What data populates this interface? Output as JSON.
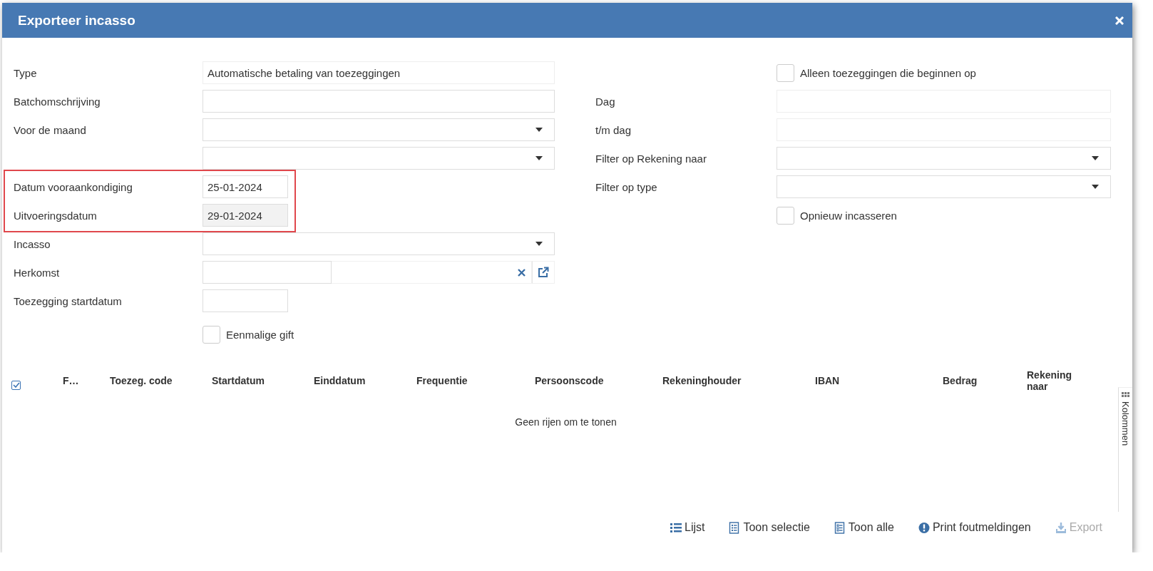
{
  "window": {
    "title": "Exporteer incasso"
  },
  "form_left": [
    {
      "kind": "text",
      "label": "Type",
      "value": "Automatische betaling van toezeggingen",
      "readonly": true
    },
    {
      "kind": "text",
      "label": "Batchomschrijving"
    },
    {
      "kind": "select",
      "label": "Voor de maand"
    },
    {
      "kind": "select"
    },
    {
      "kind": "group",
      "highlighted": true,
      "fields": [
        {
          "kind": "date",
          "label": "Datum vooraankondiging",
          "value": "25-01-2024"
        },
        {
          "kind": "date",
          "label": "Uitvoeringsdatum",
          "value": "29-01-2024",
          "disabled": true
        }
      ]
    },
    {
      "kind": "select",
      "label": "Incasso"
    },
    {
      "kind": "lookup",
      "label": "Herkomst"
    },
    {
      "kind": "date",
      "label": "Toezegging startdatum"
    },
    {
      "kind": "checkbox",
      "label": "Eenmalige gift",
      "checked": false
    }
  ],
  "form_right": [
    {
      "kind": "checkbox",
      "label": "Alleen toezeggingen die beginnen op",
      "checked": false
    },
    {
      "kind": "text",
      "label": "Dag",
      "readonly": true
    },
    {
      "kind": "text",
      "label": "t/m dag",
      "readonly": true
    },
    {
      "kind": "select",
      "label": "Filter op Rekening naar"
    },
    {
      "kind": "select",
      "label": "Filter op type"
    },
    {
      "kind": "checkbox",
      "label": "Opnieuw incasseren",
      "checked": false
    }
  ],
  "table": {
    "select_all": {
      "checked": true
    },
    "columns": [
      "F…",
      "Toezeg. code",
      "Startdatum",
      "Einddatum",
      "Frequentie",
      "Persoonscode",
      "Rekeninghouder",
      "IBAN",
      "Bedrag",
      "Rekening naar"
    ],
    "empty_message": "Geen rijen om te tonen",
    "side_tab": "Kolommen"
  },
  "footer_buttons": [
    {
      "kind": "list",
      "label": "Lijst",
      "disabled": false
    },
    {
      "kind": "selection",
      "label": "Toon selectie",
      "disabled": false
    },
    {
      "kind": "all",
      "label": "Toon alle",
      "disabled": false
    },
    {
      "kind": "errors",
      "label": "Print foutmeldingen",
      "disabled": false
    },
    {
      "kind": "export",
      "label": "Export",
      "disabled": true
    }
  ]
}
